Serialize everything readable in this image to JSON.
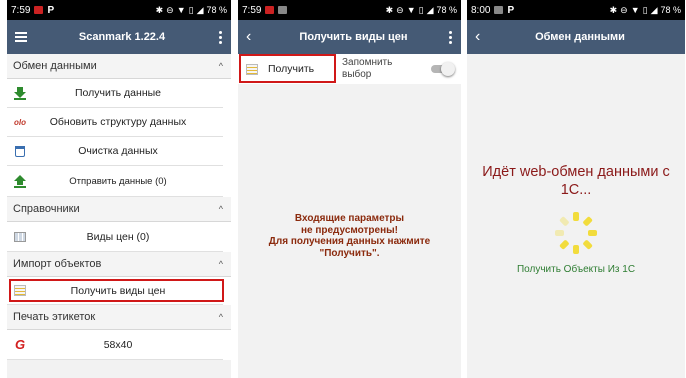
{
  "screen1": {
    "status": {
      "time": "7:59",
      "p": "P",
      "battery": "78 %"
    },
    "title": "Scanmark 1.22.4",
    "sections": [
      {
        "title": "Обмен данными",
        "items": [
          {
            "label": "Получить данные",
            "icon": "download-icon"
          },
          {
            "label": "Обновить структуру данных",
            "icon": "olo-logo-icon",
            "icon_text": "olo"
          },
          {
            "label": "Очистка данных",
            "icon": "trash-icon"
          },
          {
            "label": "Отправить данные (0)",
            "icon": "upload-icon"
          }
        ]
      },
      {
        "title": "Справочники",
        "items": [
          {
            "label": "Виды цен (0)",
            "icon": "table-icon"
          }
        ]
      },
      {
        "title": "Импорт объектов",
        "items": [
          {
            "label": "Получить виды цен",
            "icon": "list-icon"
          }
        ]
      },
      {
        "title": "Печать этикеток",
        "items": [
          {
            "label": "58x40",
            "icon": "printer-brand-icon",
            "icon_text": "G"
          }
        ]
      }
    ]
  },
  "screen2": {
    "status": {
      "time": "7:59",
      "battery": "78 %"
    },
    "title": "Получить виды цен",
    "get_button": "Получить",
    "remember_line1": "Запомнить",
    "remember_line2": "выбор",
    "remember_toggle_on": false,
    "message": [
      "Входящие параметры",
      "не предусмотрены!",
      "Для получения данных  нажмите",
      "\"Получить\"."
    ]
  },
  "screen3": {
    "status": {
      "time": "8:00",
      "p": "P",
      "battery": "78 %"
    },
    "title": "Обмен данными",
    "message_line1": "Идёт web-обмен данными с",
    "message_line2": "1С...",
    "status_text": "Получить Объекты  Из 1С"
  },
  "colors": {
    "appbar": "#455a75",
    "highlight": "#d01818",
    "spinner": "#f2dc3c",
    "message": "#8b2a0d",
    "status_green": "#2e7d32"
  }
}
